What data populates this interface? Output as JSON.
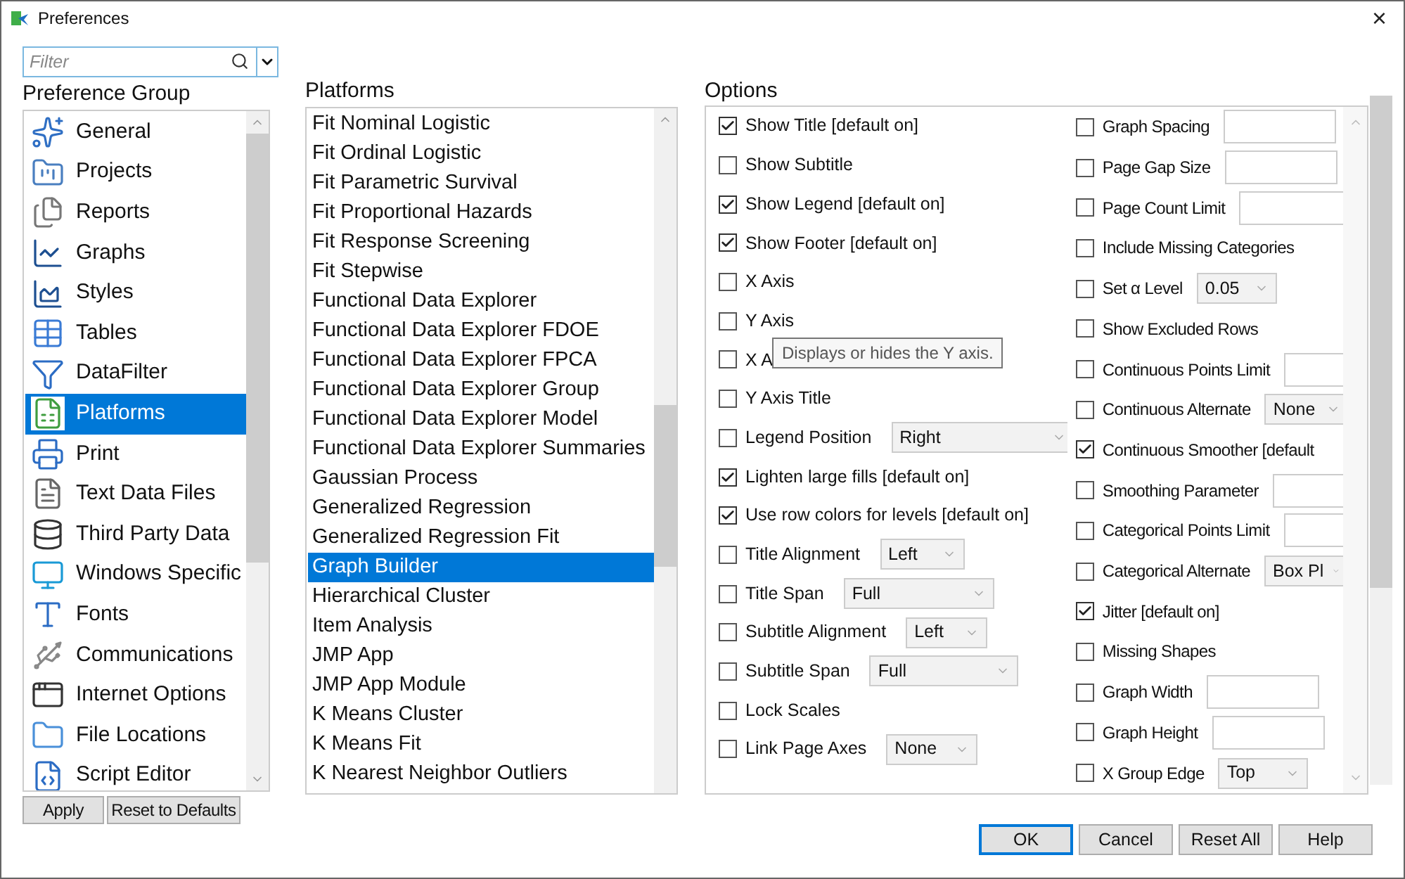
{
  "window": {
    "title": "Preferences",
    "close": "×"
  },
  "filter": {
    "placeholder": "Filter"
  },
  "preference_group": {
    "heading": "Preference Group",
    "items": [
      {
        "label": "General",
        "selected": false
      },
      {
        "label": "Projects",
        "selected": false
      },
      {
        "label": "Reports",
        "selected": false
      },
      {
        "label": "Graphs",
        "selected": false
      },
      {
        "label": "Styles",
        "selected": false
      },
      {
        "label": "Tables",
        "selected": false
      },
      {
        "label": "DataFilter",
        "selected": false
      },
      {
        "label": "Platforms",
        "selected": true
      },
      {
        "label": "Print",
        "selected": false
      },
      {
        "label": "Text Data Files",
        "selected": false
      },
      {
        "label": "Third Party Data",
        "selected": false
      },
      {
        "label": "Windows Specific",
        "selected": false
      },
      {
        "label": "Fonts",
        "selected": false
      },
      {
        "label": "Communications",
        "selected": false
      },
      {
        "label": "Internet Options",
        "selected": false
      },
      {
        "label": "File Locations",
        "selected": false
      },
      {
        "label": "Script Editor",
        "selected": false
      }
    ],
    "buttons": [
      "Apply",
      "Reset to Defaults"
    ]
  },
  "platforms": {
    "heading": "Platforms",
    "items": [
      {
        "label": "Fit Nominal Logistic",
        "selected": false
      },
      {
        "label": "Fit Ordinal Logistic",
        "selected": false
      },
      {
        "label": "Fit Parametric Survival",
        "selected": false
      },
      {
        "label": "Fit Proportional Hazards",
        "selected": false
      },
      {
        "label": "Fit Response Screening",
        "selected": false
      },
      {
        "label": "Fit Stepwise",
        "selected": false
      },
      {
        "label": "Functional Data Explorer",
        "selected": false
      },
      {
        "label": "Functional Data Explorer FDOE",
        "selected": false
      },
      {
        "label": "Functional Data Explorer FPCA",
        "selected": false
      },
      {
        "label": "Functional Data Explorer Group",
        "selected": false
      },
      {
        "label": "Functional Data Explorer Model",
        "selected": false
      },
      {
        "label": "Functional Data Explorer Summaries",
        "selected": false
      },
      {
        "label": "Gaussian Process",
        "selected": false
      },
      {
        "label": "Generalized Regression",
        "selected": false
      },
      {
        "label": "Generalized Regression Fit",
        "selected": false
      },
      {
        "label": "Graph Builder",
        "selected": true
      },
      {
        "label": "Hierarchical Cluster",
        "selected": false
      },
      {
        "label": "Item Analysis",
        "selected": false
      },
      {
        "label": "JMP App",
        "selected": false
      },
      {
        "label": "JMP App Module",
        "selected": false
      },
      {
        "label": "K Means Cluster",
        "selected": false
      },
      {
        "label": "K Means Fit",
        "selected": false
      },
      {
        "label": "K Nearest Neighbor Outliers",
        "selected": false
      }
    ]
  },
  "options": {
    "heading": "Options",
    "tooltip": "Displays or hides the Y axis.",
    "column_1": [
      {
        "kind": "check",
        "label": "Show Title [default on]",
        "checked": true
      },
      {
        "kind": "check",
        "label": "Show Subtitle",
        "checked": false
      },
      {
        "kind": "check",
        "label": "Show Legend [default on]",
        "checked": true
      },
      {
        "kind": "check",
        "label": "Show Footer [default on]",
        "checked": true
      },
      {
        "kind": "check",
        "label": "X Axis",
        "checked": false
      },
      {
        "kind": "check",
        "label": "Y Axis",
        "checked": false
      },
      {
        "kind": "check",
        "label": "X A",
        "checked": false
      },
      {
        "kind": "check",
        "label": "Y Axis Title",
        "checked": false
      },
      {
        "kind": "select",
        "label": "Legend Position",
        "checked": false,
        "value": "Right"
      },
      {
        "kind": "check",
        "label": "Lighten large fills [default on]",
        "checked": true
      },
      {
        "kind": "check",
        "label": "Use row colors for levels [default on]",
        "checked": true
      },
      {
        "kind": "select",
        "label": "Title Alignment",
        "checked": false,
        "value": "Left"
      },
      {
        "kind": "select",
        "label": "Title Span",
        "checked": false,
        "value": "Full"
      },
      {
        "kind": "select",
        "label": "Subtitle Alignment",
        "checked": false,
        "value": "Left"
      },
      {
        "kind": "select",
        "label": "Subtitle Span",
        "checked": false,
        "value": "Full"
      },
      {
        "kind": "check",
        "label": "Lock Scales",
        "checked": false
      },
      {
        "kind": "select",
        "label": "Link Page Axes",
        "checked": false,
        "value": "None"
      }
    ],
    "column_2": [
      {
        "kind": "field",
        "label": "Graph Spacing",
        "checked": false
      },
      {
        "kind": "field",
        "label": "Page Gap Size",
        "checked": false
      },
      {
        "kind": "field",
        "label": "Page Count Limit",
        "checked": false
      },
      {
        "kind": "check",
        "label": "Include Missing Categories",
        "checked": false
      },
      {
        "kind": "select",
        "label": "Set α Level",
        "checked": false,
        "value": "0.05"
      },
      {
        "kind": "check",
        "label": "Show Excluded Rows",
        "checked": false
      },
      {
        "kind": "field",
        "label": "Continuous Points Limit",
        "checked": false
      },
      {
        "kind": "select",
        "label": "Continuous Alternate",
        "checked": false,
        "value": "None"
      },
      {
        "kind": "check",
        "label": "Continuous Smoother [default",
        "checked": true
      },
      {
        "kind": "field",
        "label": "Smoothing Parameter",
        "checked": false
      },
      {
        "kind": "field",
        "label": "Categorical Points Limit",
        "checked": false
      },
      {
        "kind": "select",
        "label": "Categorical Alternate",
        "checked": false,
        "value": "Box Pl"
      },
      {
        "kind": "check",
        "label": "Jitter [default on]",
        "checked": true
      },
      {
        "kind": "check",
        "label": "Missing Shapes",
        "checked": false
      },
      {
        "kind": "field",
        "label": "Graph Width",
        "checked": false
      },
      {
        "kind": "field",
        "label": "Graph Height",
        "checked": false
      },
      {
        "kind": "select",
        "label": "X Group Edge",
        "checked": false,
        "value": "Top"
      }
    ]
  },
  "buttons": [
    "OK",
    "Cancel",
    "Reset All",
    "Help"
  ]
}
